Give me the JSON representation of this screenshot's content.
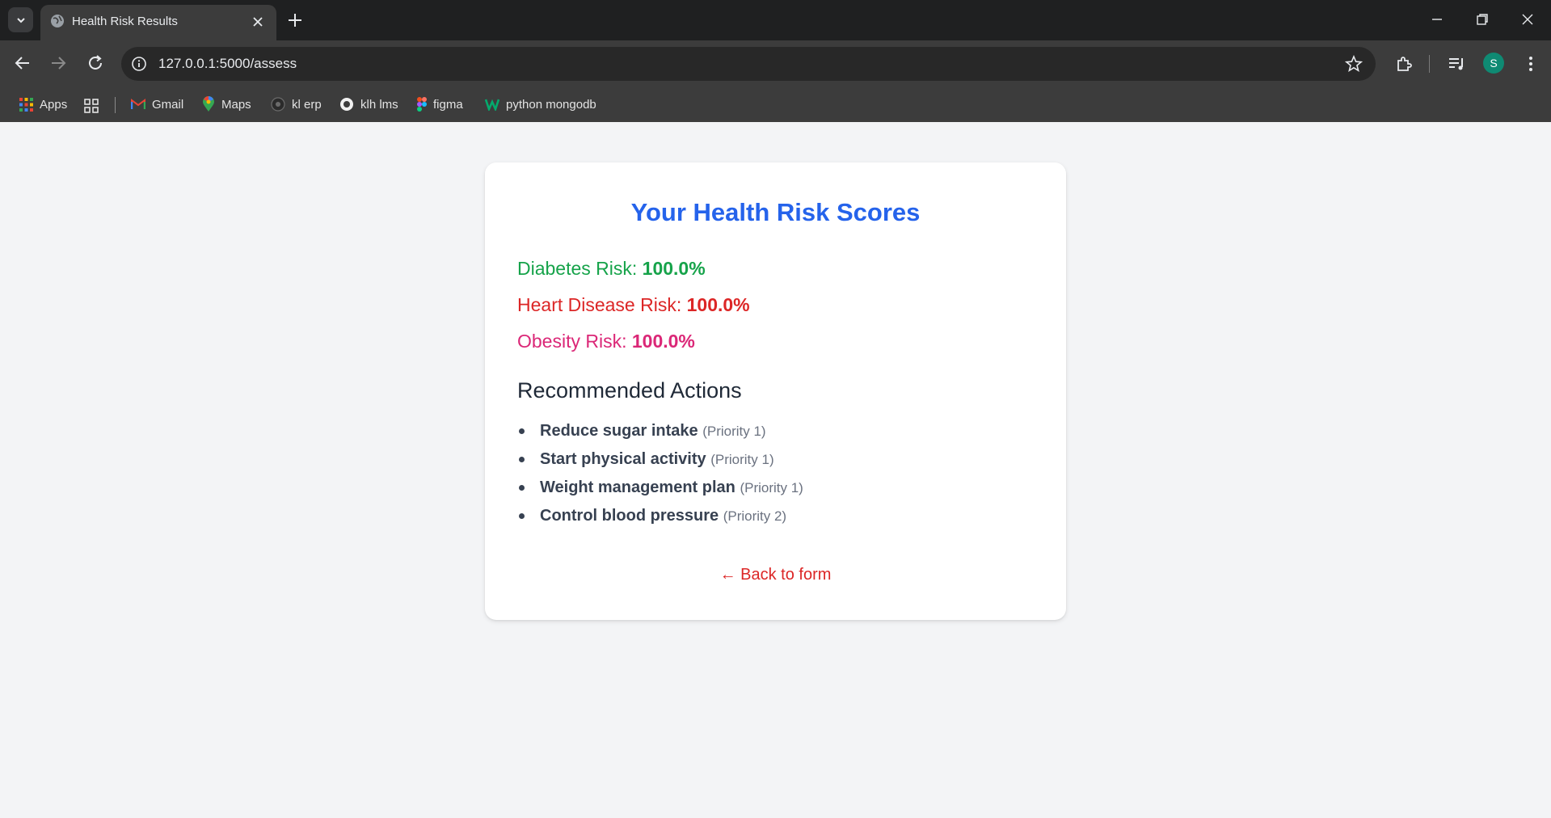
{
  "browser": {
    "tab_title": "Health Risk Results",
    "url": "127.0.0.1:5000/assess",
    "avatar_initial": "S",
    "bookmarks": [
      {
        "label": "Apps",
        "icon": "apps-grid-icon"
      },
      {
        "label": "Gmail",
        "icon": "gmail-icon"
      },
      {
        "label": "Maps",
        "icon": "maps-icon"
      },
      {
        "label": "kl erp",
        "icon": "erp-icon"
      },
      {
        "label": "klh lms",
        "icon": "lms-icon"
      },
      {
        "label": "figma",
        "icon": "figma-icon"
      },
      {
        "label": "python mongodb",
        "icon": "w3schools-icon"
      }
    ]
  },
  "results": {
    "title": "Your Health Risk Scores",
    "risks": [
      {
        "label": "Diabetes Risk: ",
        "value": "100.0%",
        "color": "#16a34a"
      },
      {
        "label": "Heart Disease Risk: ",
        "value": "100.0%",
        "color": "#dc2626"
      },
      {
        "label": "Obesity Risk: ",
        "value": "100.0%",
        "color": "#db2777"
      }
    ],
    "actions_title": "Recommended Actions",
    "actions": [
      {
        "action": "Reduce sugar intake",
        "priority": "(Priority 1)"
      },
      {
        "action": "Start physical activity",
        "priority": "(Priority 1)"
      },
      {
        "action": "Weight management plan",
        "priority": "(Priority 1)"
      },
      {
        "action": "Control blood pressure",
        "priority": "(Priority 2)"
      }
    ],
    "back_link": "← Back to form"
  },
  "colors": {
    "title": "#2563eb",
    "page_bg": "#f3f4f6",
    "card_bg": "#ffffff"
  }
}
